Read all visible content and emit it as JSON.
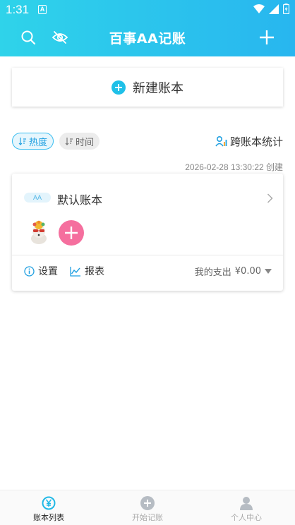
{
  "status_bar": {
    "time": "1:31",
    "notification_glyph": "A"
  },
  "header": {
    "title": "百事AA记账"
  },
  "new_book": {
    "label": "新建账本"
  },
  "sort": {
    "hot_label": "热度",
    "time_label": "时间"
  },
  "cross_stat_label": "跨账本统计",
  "book": {
    "created_note": "2026-02-28 13:30:22 创建",
    "badge": "AA",
    "name": "默认账本",
    "settings_label": "设置",
    "report_label": "报表",
    "my_spend_label": "我的支出",
    "my_spend_value": "¥0.00"
  },
  "tabbar": {
    "tabs": [
      {
        "label": "账本列表",
        "active": true
      },
      {
        "label": "开始记账",
        "active": false
      },
      {
        "label": "个人中心",
        "active": false
      }
    ]
  },
  "colors": {
    "header_start": "#2fd3ea",
    "header_end": "#28b6ef",
    "accent": "#1fb8e6",
    "add_member": "#f56f9e"
  }
}
